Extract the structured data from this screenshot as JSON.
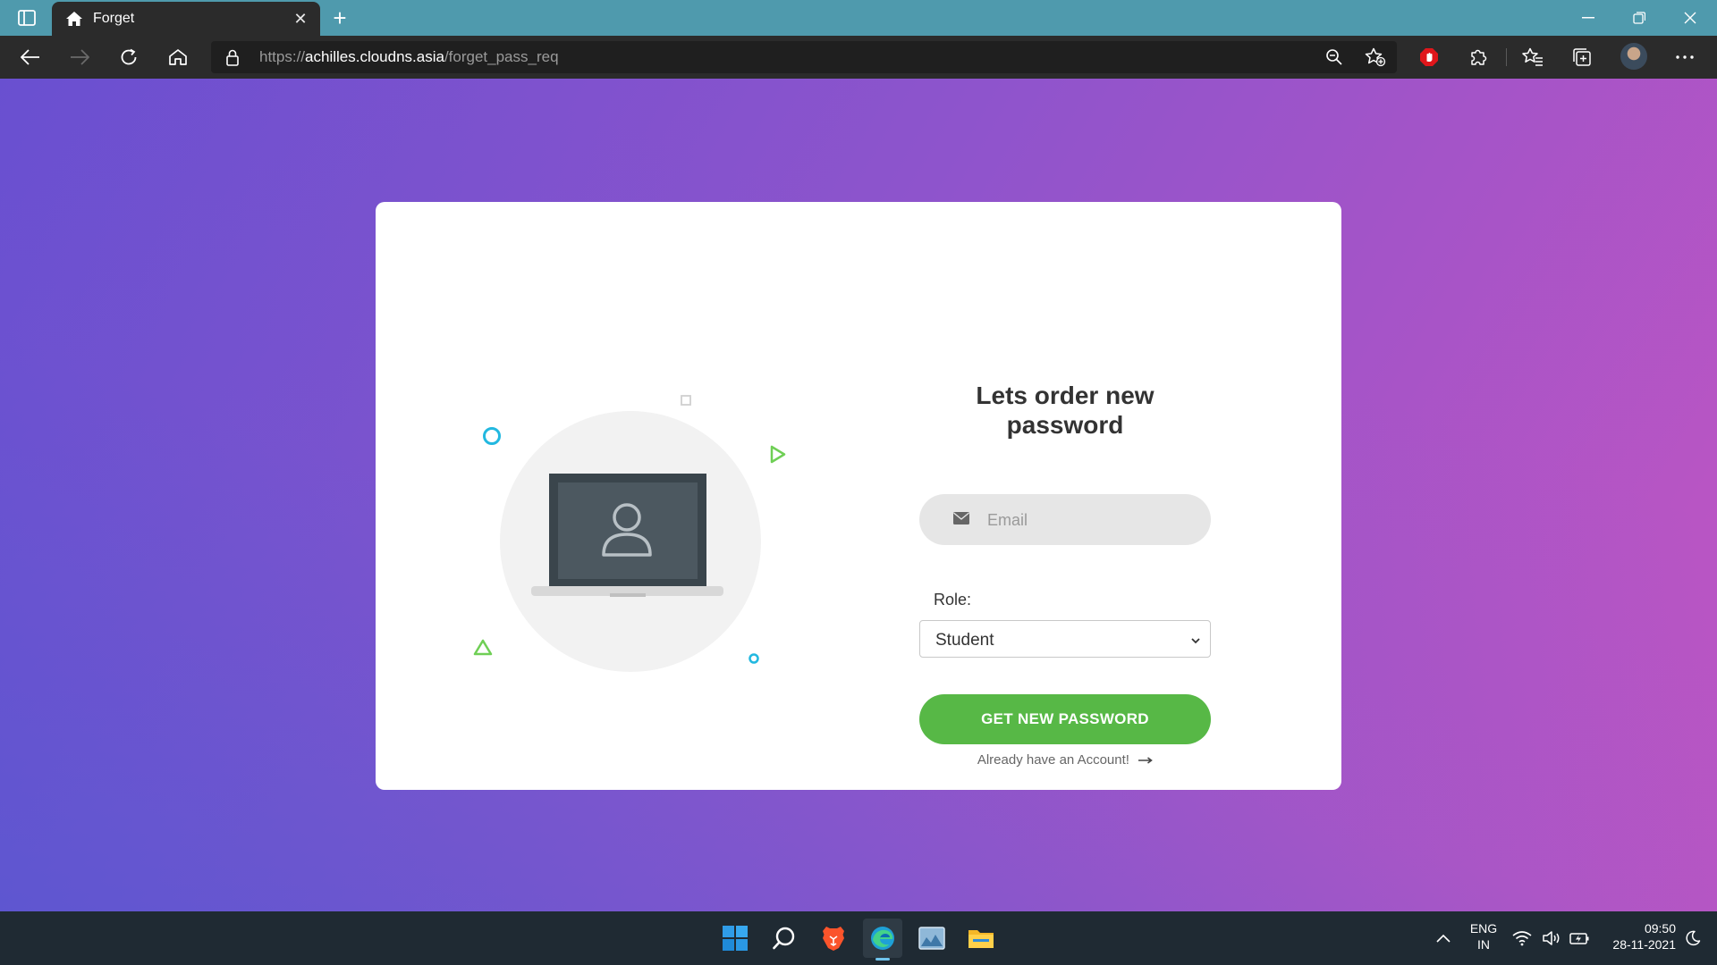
{
  "browser": {
    "tab_title": "Forget",
    "close_tab_label": "✕",
    "new_tab_label": "+",
    "url_scheme": "https://",
    "url_host": "achilles.cloudns.asia",
    "url_path": "/forget_pass_req"
  },
  "page": {
    "title_line1": "Lets order new",
    "title_line2": "password",
    "email_placeholder": "Email",
    "role_label": "Role:",
    "role_selected": "Student",
    "submit_label": "GET NEW PASSWORD",
    "login_link": "Already have an Account!"
  },
  "taskbar": {
    "lang_line1": "ENG",
    "lang_line2": "IN",
    "time": "09:50",
    "date": "28-11-2021"
  },
  "colors": {
    "accent_green": "#57b846",
    "titlebar": "#4f9aad",
    "toolbar": "#2b2b2b"
  }
}
